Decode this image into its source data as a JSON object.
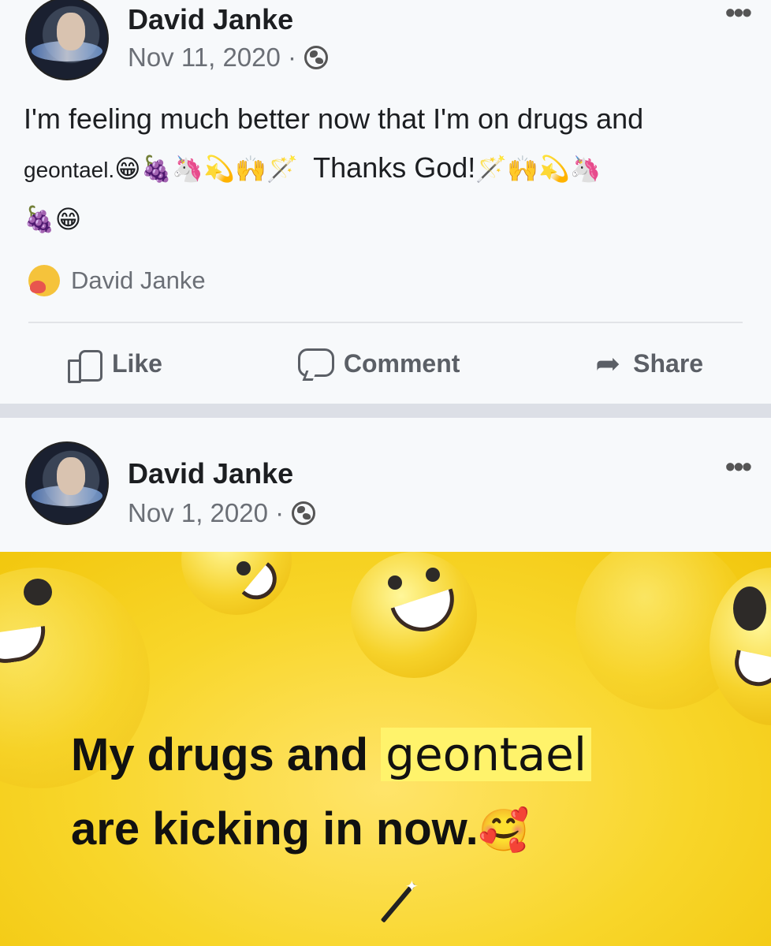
{
  "post1": {
    "author": "David Janke",
    "date": "Nov 11, 2020 ·",
    "text_line1": "I'm feeling much better now that I'm on drugs and",
    "text_line2_a": "geontael.",
    "text_line2_b": "Thanks God!",
    "emoji_after_word": "😁🍇🦄💫🙌🪄",
    "emoji_after_thanks": "🪄🙌💫🦄",
    "emoji_line3": "🍇😁",
    "reaction_name": "David Janke",
    "actions": {
      "like": "Like",
      "comment": "Comment",
      "share": "Share"
    }
  },
  "post2": {
    "author": "David Janke",
    "date": "Nov 1, 2020 ·",
    "image_text_line1_bold": "My drugs and",
    "image_text_line1_highlight": "geontael",
    "image_text_line2": "are kicking in now.",
    "image_text_emoji": "🥰"
  },
  "icons": {
    "privacy": "globe-icon",
    "more": "more-options-icon",
    "reaction": "care-reaction-icon",
    "like": "like-icon",
    "comment": "comment-icon",
    "share": "share-icon",
    "wand": "magic-wand-icon"
  },
  "colors": {
    "post_bg": "#f7f9fb",
    "divider": "#dcdfe6",
    "secondary_text": "#6b6f76",
    "image_yellow": "#f8d62a",
    "highlight": "#fff36b"
  }
}
